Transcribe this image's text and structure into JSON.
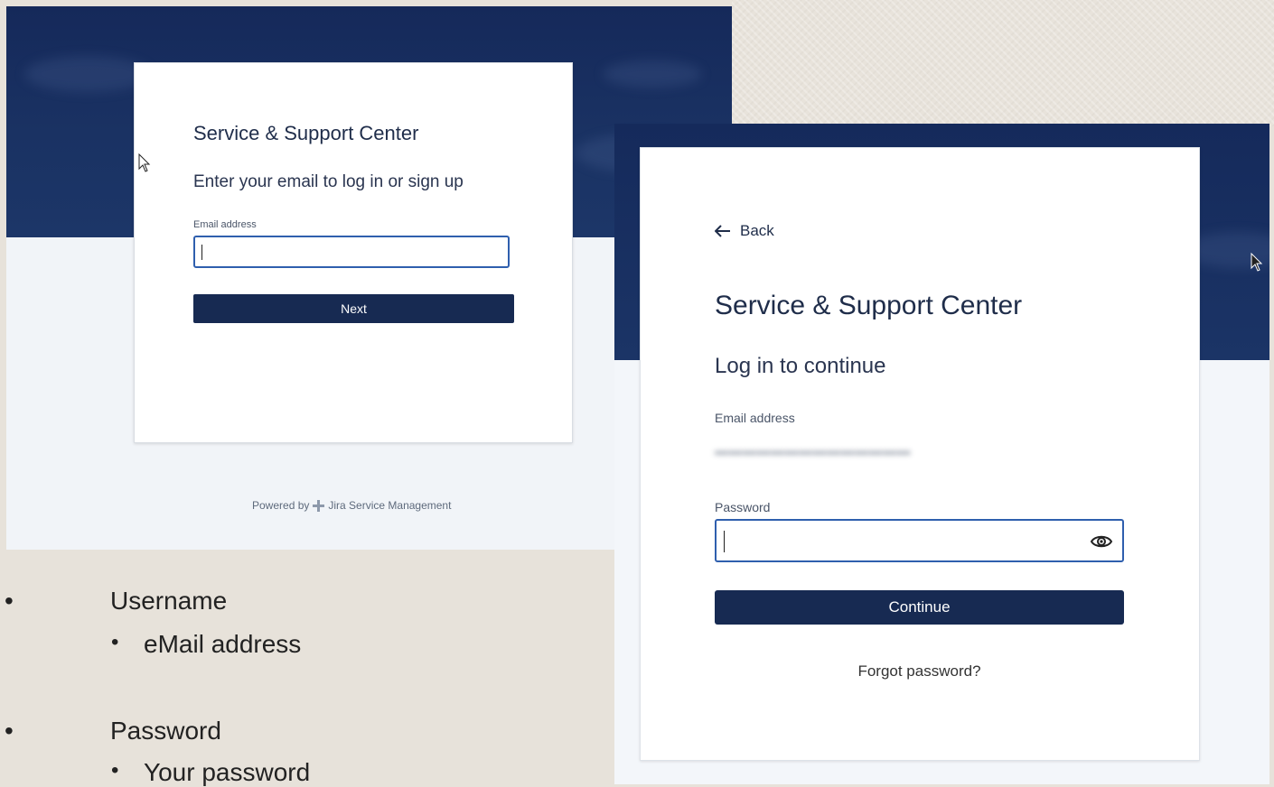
{
  "login_step1": {
    "title": "Service & Support Center",
    "subtitle": "Enter your email to log in or sign up",
    "email_label": "Email address",
    "next_button": "Next",
    "powered_by": "Powered by",
    "powered_brand": "Jira Service Management"
  },
  "login_step2": {
    "back_label": "Back",
    "title": "Service & Support Center",
    "subtitle": "Log in to continue",
    "email_label": "Email address",
    "password_label": "Password",
    "continue_button": "Continue",
    "forgot_link": "Forgot password?"
  },
  "bullets": [
    {
      "title": "Username",
      "sub": "eMail address"
    },
    {
      "title": "Password",
      "sub": "Your password"
    }
  ],
  "colors": {
    "brand_navy": "#172a52",
    "focus_blue": "#2f5fae"
  }
}
